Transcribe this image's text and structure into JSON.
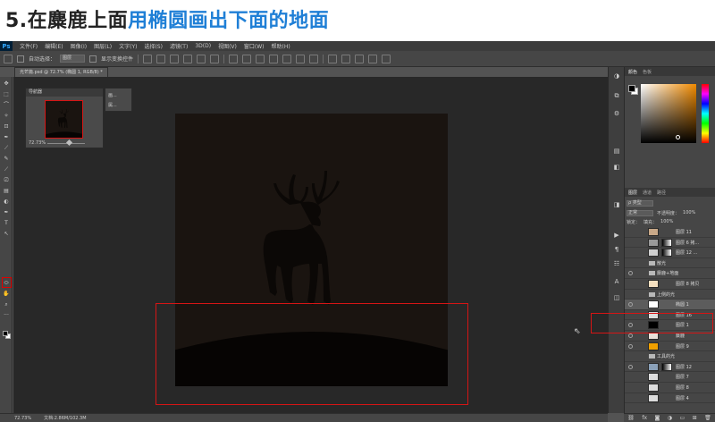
{
  "banner": {
    "title_prefix": "5.在麋鹿上面",
    "title_accent": "用椭圆画出下面的地面"
  },
  "app": {
    "logo": "Ps"
  },
  "menu": [
    "文件(F)",
    "编辑(E)",
    "图像(I)",
    "图层(L)",
    "文字(Y)",
    "选择(S)",
    "滤镜(T)",
    "3D(D)",
    "视图(V)",
    "窗口(W)",
    "帮助(H)"
  ],
  "options": {
    "auto_select_label": "自动选择：",
    "auto_select_value": "图层",
    "transform_label": "显示变换控件"
  },
  "document": {
    "tab_title": "光芒篇.psd @ 72.7% (椭圆 1, RGB/8) *"
  },
  "navigator": {
    "title": "导航器",
    "zoom": "72.73%"
  },
  "mini_panel": {
    "row1": "画...",
    "row2": "属..."
  },
  "tools": [
    "✥",
    "⬚",
    "⌒",
    "✧",
    "⊡",
    "✒",
    "⟋",
    "✎",
    "⟋",
    "⎚",
    "▤",
    "◐",
    "✒",
    "T",
    "↖",
    "⬭",
    "✋",
    "⌕",
    "···"
  ],
  "dock_icons": [
    "◑",
    "⧉",
    "⚙",
    "▤",
    "◧",
    "◨",
    "▶",
    "¶",
    "☷",
    "A",
    "◫"
  ],
  "color_panel": {
    "tab_active": "颜色",
    "tab_other": "色板"
  },
  "layers_panel": {
    "tabs": [
      "图层",
      "通道",
      "路径"
    ],
    "filter_label": "ρ 类型",
    "blend_mode": "正常",
    "opacity_label": "不透明度：",
    "opacity_value": "100%",
    "lock_label": "锁定：",
    "fill_label": "填充：",
    "fill_value": "100%",
    "layers": [
      {
        "name": "图层 11",
        "visible": false,
        "thumb": "#c8a888",
        "mask": false,
        "group": false,
        "selected": false
      },
      {
        "name": "图层 6 拷...",
        "visible": false,
        "thumb": "#9a9a9a",
        "mask": true,
        "group": false,
        "selected": false
      },
      {
        "name": "图层 12 ...",
        "visible": false,
        "thumb": "#cfcfcf",
        "mask": true,
        "group": false,
        "selected": false
      },
      {
        "name": "散光",
        "visible": false,
        "thumb": "",
        "mask": false,
        "group": true,
        "selected": false
      },
      {
        "name": "麋鹿+地面",
        "visible": true,
        "thumb": "",
        "mask": false,
        "group": true,
        "selected": false
      },
      {
        "name": "图层 8 拷贝",
        "visible": false,
        "thumb": "#f4dfc0",
        "mask": false,
        "group": false,
        "selected": false
      },
      {
        "name": "上侧的光",
        "visible": false,
        "thumb": "",
        "mask": false,
        "group": true,
        "selected": false
      },
      {
        "name": "椭圆 1",
        "visible": true,
        "thumb": "#ffffff",
        "mask": false,
        "group": false,
        "selected": true
      },
      {
        "name": "图层 16",
        "visible": false,
        "thumb": "#dcdcdc",
        "mask": false,
        "group": false,
        "selected": false
      },
      {
        "name": "图层 1",
        "visible": true,
        "thumb": "#000000",
        "mask": false,
        "group": false,
        "selected": false
      },
      {
        "name": "麋鹿",
        "visible": true,
        "thumb": "#e8e0d8",
        "mask": false,
        "group": false,
        "selected": false
      },
      {
        "name": "图层 9",
        "visible": true,
        "thumb": "#f0a000",
        "mask": false,
        "group": false,
        "selected": false
      },
      {
        "name": "工具的光",
        "visible": false,
        "thumb": "",
        "mask": false,
        "group": true,
        "selected": false
      },
      {
        "name": "图层 12",
        "visible": true,
        "thumb": "#8aa0b8",
        "mask": true,
        "group": false,
        "selected": false
      },
      {
        "name": "图层 7",
        "visible": false,
        "thumb": "#dcdcdc",
        "mask": false,
        "group": false,
        "selected": false
      },
      {
        "name": "图层 8",
        "visible": false,
        "thumb": "#dcdcdc",
        "mask": false,
        "group": false,
        "selected": false
      },
      {
        "name": "图层 4",
        "visible": false,
        "thumb": "#dcdcdc",
        "mask": false,
        "group": false,
        "selected": false
      }
    ]
  },
  "status": {
    "zoom": "72.73%",
    "doc_size": "文档:2.86M/102.3M"
  },
  "footer_icons": [
    "⛓",
    "fx",
    "◙",
    "◑",
    "▭",
    "⊞",
    "🗑"
  ],
  "colors": {
    "accent": "#1f7fd6",
    "highlight": "#d61515",
    "canvas": "#1a1410"
  }
}
